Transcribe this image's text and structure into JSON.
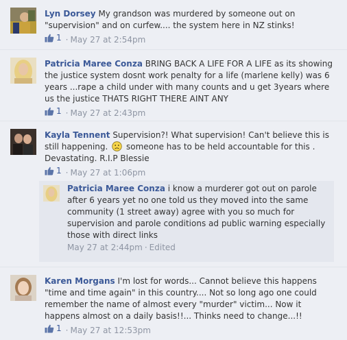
{
  "comments": [
    {
      "author": "Lyn Dorsey",
      "avatar_icon": "profile-photo-lyn-dorsey",
      "text": "My grandson was murdered by someone out on \"supervision\" and on curfew.... the system here in NZ stinks!",
      "likes": "1",
      "separator": "·",
      "time": "May 27 at 2:54pm"
    },
    {
      "author": "Patricia Maree Conza",
      "avatar_icon": "profile-photo-patricia-maree-conza",
      "text": "BRING BACK A LIFE FOR A LIFE as its showing the justice system dosnt work penalty for a life (marlene kelly) was 6 years ...rape a child under with many counts and u get 3years where us the justice THATS RIGHT THERE AINT ANY",
      "likes": "1",
      "separator": "·",
      "time": "May 27 at 2:43pm"
    },
    {
      "author": "Kayla Tennent",
      "avatar_icon": "profile-photo-kayla-tennent",
      "text_before_emoticon": "Supervision?! What supervision! Can't believe this is still happening.",
      "emoticon": "frown-emoticon",
      "text_after_emoticon": "someone has to be held accountable for this . Devastating. R.I.P Blessie",
      "likes": "1",
      "separator": "·",
      "time": "May 27 at 1:06pm",
      "reply": {
        "author": "Patricia Maree Conza",
        "avatar_icon": "profile-photo-patricia-maree-conza",
        "text": "i know a murderer got out on parole after 6 years yet no one told us they moved into the same community (1 street away) agree with you so much for supervision and parole conditions ad public warning especially those with direct links",
        "time": "May 27 at 2:44pm",
        "separator": "·",
        "edited": "Edited"
      }
    },
    {
      "author": "Karen Morgans",
      "avatar_icon": "profile-photo-karen-morgans",
      "text": "I'm lost for words... Cannot believe this happens \"time and time again\" in this country.... Not so long ago one could remember the name of almost every \"murder\" victim... Now it happens almost on a daily basis!!... Thinks need to change...!!",
      "likes": "1",
      "separator": "·",
      "time": "May 27 at 12:53pm"
    }
  ],
  "colors": {
    "background": "#edeff4",
    "reply_background": "#e4e7ee",
    "author_link": "#3b5998",
    "meta_text": "#8e95a3"
  }
}
